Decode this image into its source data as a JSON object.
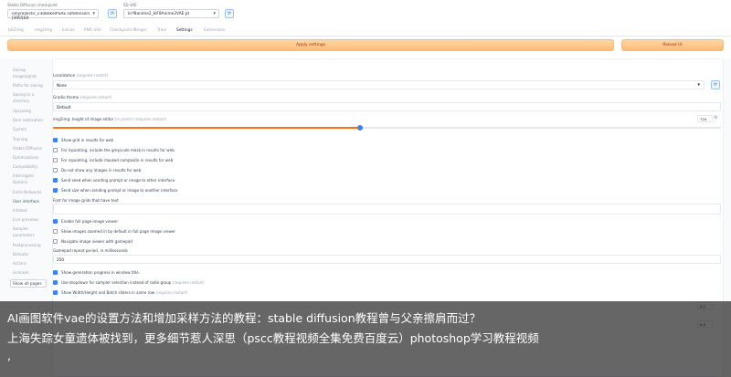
{
  "header": {
    "checkpoint_label": "Stable Diffusion checkpoint",
    "checkpoint_value": "onlyrealistic_v30Baked%AE.safetensors [3955S4",
    "vae_label": "SD VAE",
    "vae_value": "kl-f8anime2_klF8Anime2VAE.pt",
    "refresh_glyph": "⟳"
  },
  "tabs": [
    {
      "label": "txt2img"
    },
    {
      "label": "img2img"
    },
    {
      "label": "Extras"
    },
    {
      "label": "PNG Info"
    },
    {
      "label": "Checkpoint Merger"
    },
    {
      "label": "Train"
    },
    {
      "label": "Settings"
    },
    {
      "label": "Extensions"
    }
  ],
  "active_tab": "Settings",
  "apply_button": "Apply settings",
  "reload_button": "Reload UI",
  "sidebar": {
    "items": [
      "Saving",
      "images/grids",
      "Paths for saving",
      "Saving to a",
      "directory",
      "Upscaling",
      "Face restoration",
      "System",
      "Training",
      "Stable Diffusion",
      "Optimizations",
      "Compatibility",
      "Interrogate",
      "Options",
      "Extra Networks",
      "User interface",
      "Infotext",
      "Live previews",
      "Sampler",
      "parameters",
      "Postprocessing",
      "Defaults",
      "Actions",
      "Licenses"
    ],
    "show_all": "Show all pages"
  },
  "settings": {
    "localization_label": "Localization",
    "localization_hint": "(requires restart)",
    "localization_value": "None",
    "theme_label": "Gradio theme",
    "theme_hint": "(requires restart)",
    "theme_value": "Default",
    "img2img_height_label": "img2img: height of image editor",
    "img2img_height_hint": "(in pixels) (requires restart)",
    "img2img_height_value": "720",
    "slider_fraction": 0.46,
    "checkboxes_a": [
      {
        "label": "Show grid in results for web",
        "checked": true
      },
      {
        "label": "For inpainting, include the greyscale mask in results for web",
        "checked": false
      },
      {
        "label": "For inpainting, include masked composite in results for web",
        "checked": false
      },
      {
        "label": "Do not show any images in results for web",
        "checked": false
      },
      {
        "label": "Send seed when sending prompt or image to other interface",
        "checked": true
      },
      {
        "label": "Send size when sending prompt or image to another interface",
        "checked": true
      }
    ],
    "font_label": "Font for image grids that have text",
    "checkboxes_b": [
      {
        "label": "Enable full page image viewer",
        "checked": true
      },
      {
        "label": "Show images zoomed in by default in full page image viewer",
        "checked": false
      },
      {
        "label": "Navigate image viewer with gamepad",
        "checked": false
      }
    ],
    "gamepad_label": "Gamepad repeat period, in milliseconds",
    "gamepad_value": "250",
    "checkboxes_c": [
      {
        "label": "Show generation progress in window title.",
        "checked": true
      },
      {
        "label": "Use dropdown for sampler selection instead of radio group",
        "checked": true,
        "hint": "(requires restart)"
      },
      {
        "label": "Show Width/Height and Batch sliders in same row",
        "checked": true,
        "hint": "(requires restart)"
      }
    ],
    "partial_row_value": "0.2",
    "partial_row2_value": "0.5"
  },
  "caption": {
    "line1": "AI画图软件vae的设置方法和增加采样方法的教程：stable diffusion教程曾与父亲擦肩而过？",
    "line2": "上海失踪女童遗体被找到，更多细节惹人深思（pscc教程视频全集免费百度云）photoshop学习教程视频",
    "line3": ","
  },
  "colors": {
    "accent": "#3b82f6",
    "orange": "#fdba74",
    "slider_track": "#f97316"
  }
}
